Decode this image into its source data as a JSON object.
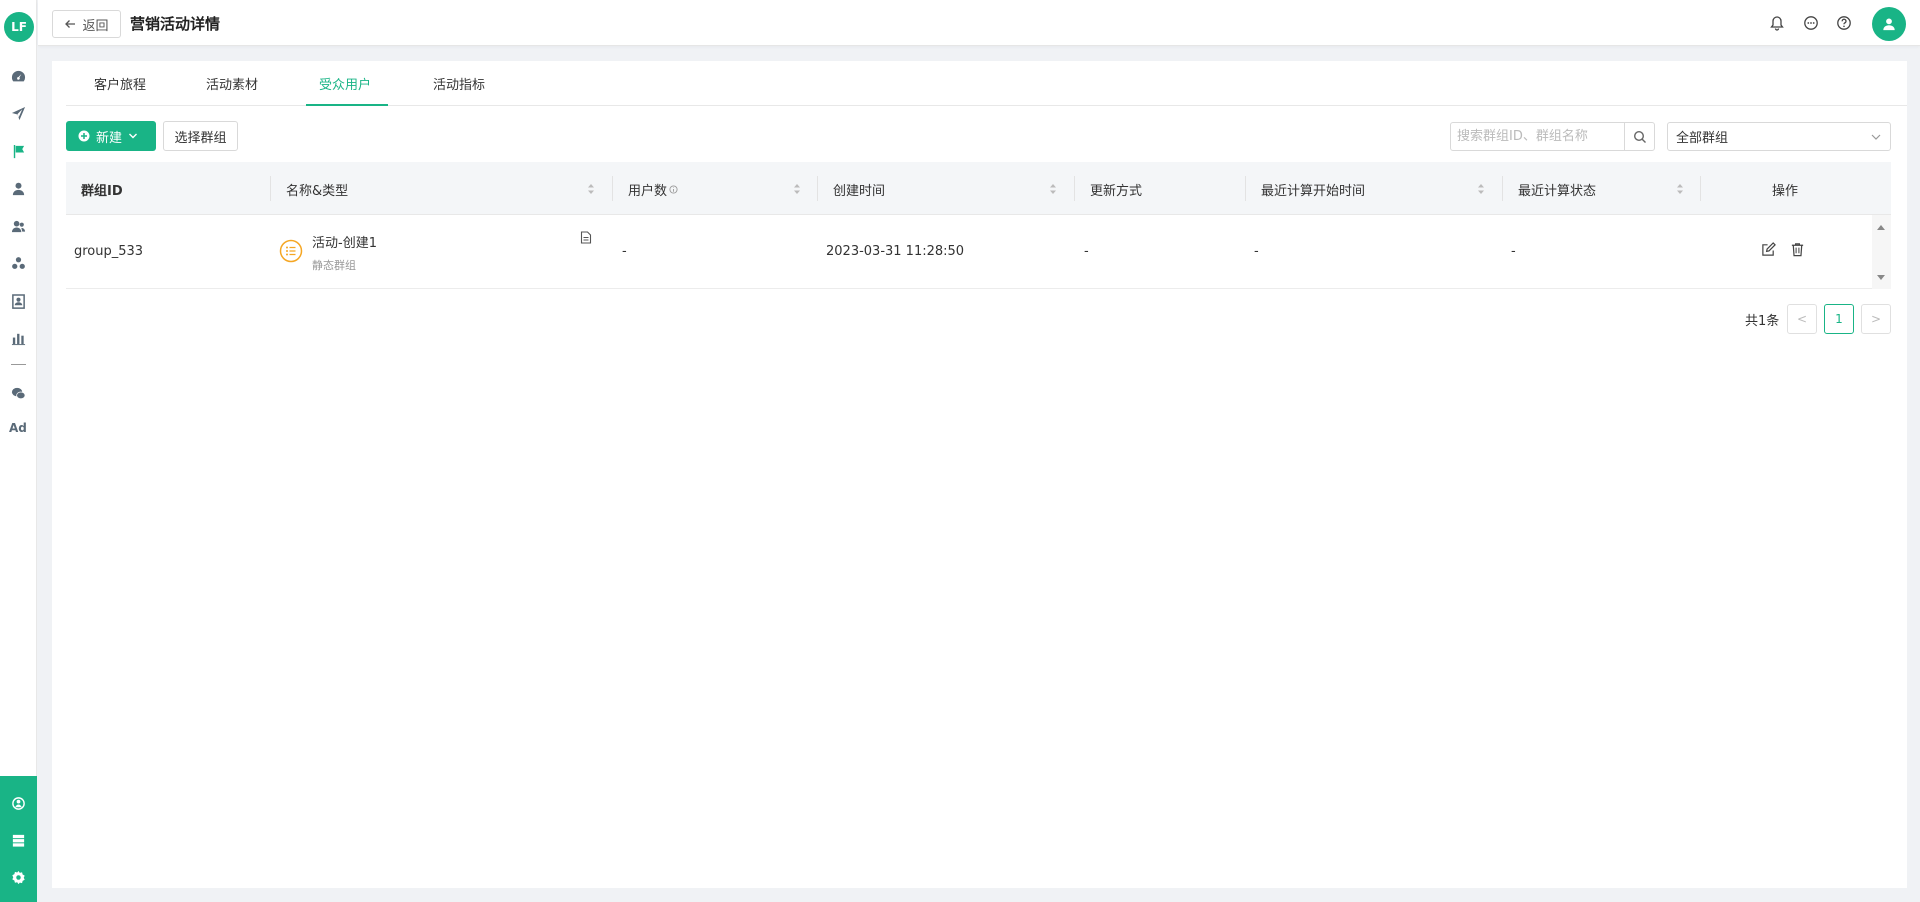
{
  "app": {
    "logo_text": "LF"
  },
  "header": {
    "back_label": "返回",
    "title": "营销活动详情"
  },
  "sidebar": {
    "items": [
      "dashboard-icon",
      "send-icon",
      "flag-icon",
      "user-icon",
      "users-icon",
      "cluster-icon",
      "portrait-icon",
      "bar-chart-icon",
      "wechat-icon"
    ],
    "ad_label": "Ad",
    "bottom_items": [
      "hub-icon",
      "server-icon",
      "settings-icon"
    ]
  },
  "tabs": [
    {
      "label": "客户旅程",
      "active": false
    },
    {
      "label": "活动素材",
      "active": false
    },
    {
      "label": "受众用户",
      "active": true
    },
    {
      "label": "活动指标",
      "active": false
    }
  ],
  "toolbar": {
    "new_label": "新建",
    "select_group_label": "选择群组",
    "search_placeholder": "搜索群组ID、群组名称",
    "filter_value": "全部群组"
  },
  "table": {
    "columns": [
      "群组ID",
      "名称&类型",
      "用户数",
      "创建时间",
      "更新方式",
      "最近计算开始时间",
      "最近计算状态",
      "操作"
    ],
    "rows": [
      {
        "group_id": "group_533",
        "name": "活动-创建1",
        "type": "静态群组",
        "users": "-",
        "created": "2023-03-31 11:28:50",
        "update_mode": "-",
        "last_calc_start": "-",
        "last_calc_status": "-"
      }
    ]
  },
  "pagination": {
    "total_label": "共1条",
    "current_page": "1",
    "prev": "<",
    "next": ">"
  },
  "colors": {
    "accent": "#19b486",
    "group_icon": "#f5a623"
  }
}
